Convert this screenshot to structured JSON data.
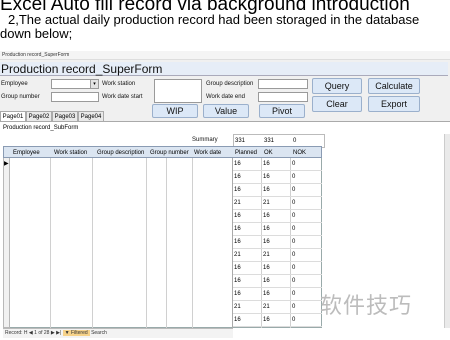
{
  "slide": {
    "title": "Excel Auto fill record via background introduction",
    "subtitle_line1": "2,The actual daily production record had been storaged in the database",
    "subtitle_line2": "down below;"
  },
  "window": {
    "title": "Production record_SuperForm",
    "form_title": "Production record_SuperForm"
  },
  "filters": {
    "employee_label": "Employee",
    "group_number_label": "Group number",
    "work_station_label": "Work station",
    "work_date_start_label": "Work date start",
    "group_description_label": "Group description",
    "work_date_end_label": "Work date end",
    "employee_value": "",
    "group_number_value": "",
    "work_station_value": "",
    "work_date_start_value": "",
    "group_description_value": "",
    "work_date_end_value": ""
  },
  "buttons": {
    "query": "Query",
    "calculate": "Calculate",
    "clear": "Clear",
    "export": "Export",
    "wip": "WIP",
    "value": "Value",
    "pivot": "Pivot"
  },
  "tabs": [
    "Page01",
    "Page02",
    "Page03",
    "Page04"
  ],
  "subform": {
    "label": "Production record_SubForm",
    "summary_label": "Summary",
    "summary": [
      "331",
      "331",
      "0"
    ],
    "columns": [
      "Employee",
      "Work station",
      "Group description",
      "Group number",
      "Work date"
    ],
    "stat_columns": [
      "Planned",
      "OK",
      "NOK"
    ],
    "rows": [
      [
        "16",
        "16",
        "0"
      ],
      [
        "16",
        "16",
        "0"
      ],
      [
        "16",
        "16",
        "0"
      ],
      [
        "21",
        "21",
        "0"
      ],
      [
        "16",
        "16",
        "0"
      ],
      [
        "16",
        "16",
        "0"
      ],
      [
        "16",
        "16",
        "0"
      ],
      [
        "21",
        "21",
        "0"
      ],
      [
        "16",
        "16",
        "0"
      ],
      [
        "16",
        "16",
        "0"
      ],
      [
        "16",
        "16",
        "0"
      ],
      [
        "21",
        "21",
        "0"
      ],
      [
        "16",
        "16",
        "0"
      ]
    ]
  },
  "navigation": {
    "record_label": "Record: H",
    "position": "1 of 28",
    "filter_label": "Filtered",
    "search_label": "Search"
  },
  "watermark": "软件技巧",
  "colors": {
    "header_fill": "#dbe5f1",
    "button_fill": "#dce8f7",
    "form_title_fill": "#e6edf7"
  }
}
